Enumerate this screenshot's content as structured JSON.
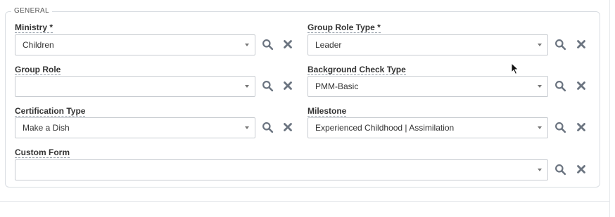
{
  "section": {
    "legend": "GENERAL"
  },
  "fields": {
    "ministry": {
      "label": "Ministry *",
      "value": "Children"
    },
    "group_role_type": {
      "label": "Group Role Type *",
      "value": "Leader"
    },
    "group_role": {
      "label": "Group Role",
      "value": ""
    },
    "background_check_type": {
      "label": "Background Check Type",
      "value": "PMM-Basic"
    },
    "certification_type": {
      "label": "Certification Type",
      "value": "Make a Dish"
    },
    "milestone": {
      "label": "Milestone",
      "value": "Experienced Childhood | Assimilation"
    },
    "custom_form": {
      "label": "Custom Form",
      "value": ""
    }
  },
  "icons": {
    "search": "search-icon",
    "clear": "close-icon"
  },
  "colors": {
    "icon": "#6b7480",
    "border": "#c8ccd1"
  }
}
